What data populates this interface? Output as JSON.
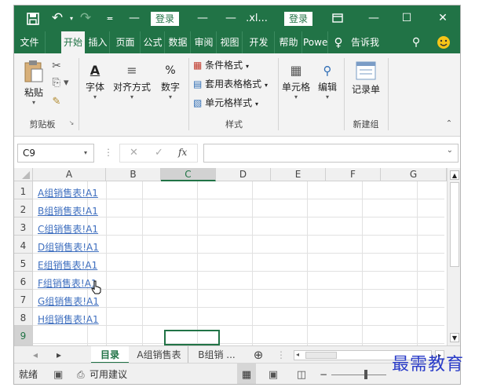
{
  "titlebar": {
    "save_icon": "save-icon",
    "undo_icon": "undo-icon",
    "redo_icon": "redo-icon",
    "customize_icon": "customize-qat-icon",
    "login_label": "登录",
    "filename": ".xl...",
    "login_label2": "登录",
    "ribbon_display_icon": "ribbon-display-icon",
    "minimize": "—",
    "maximize": "☐",
    "close": "✕"
  },
  "menu": {
    "items": [
      "文件",
      "开始",
      "插入",
      "页面",
      "公式",
      "数据",
      "审阅",
      "视图",
      "开发",
      "帮助",
      "Powe",
      "告诉我"
    ],
    "tell_icon": "lightbulb-icon",
    "share_icon": "share-icon",
    "smile_icon": "smiley-icon"
  },
  "ribbon": {
    "paste": "粘贴",
    "clipboard_group": "剪贴板",
    "font": "字体",
    "align": "对齐方式",
    "number": "数字",
    "cond_format": "条件格式",
    "table_format": "套用表格格式",
    "cell_style": "单元格样式",
    "styles_group": "样式",
    "cells": "单元格",
    "edit": "编辑",
    "record": "记录单",
    "new_group": "新建组",
    "percent_icon": "%",
    "font_icon": "A"
  },
  "formula_bar": {
    "cell_ref": "C9",
    "fx": "fx",
    "formula": ""
  },
  "columns": [
    "A",
    "B",
    "C",
    "D",
    "E",
    "F",
    "G"
  ],
  "rows": [
    "1",
    "2",
    "3",
    "4",
    "5",
    "6",
    "7",
    "8",
    "9"
  ],
  "cells": [
    "A组销售表!A1",
    "B组销售表!A1",
    "C组销售表!A1",
    "D组销售表!A1",
    "E组销售表!A1",
    "F组销售表!A1",
    "G组销售表!A1",
    "H组销售表!A1"
  ],
  "sheet_tabs": {
    "prev": "◂",
    "next": "▸",
    "tabs": [
      "目录",
      "A组销售表",
      "B组销 ..."
    ],
    "add": "⊕"
  },
  "status": {
    "ready": "就绪",
    "accessibility": "可用建议",
    "zoom_minus": "−",
    "zoom_plus": "+"
  },
  "watermark": "最需教育",
  "colors": {
    "accent": "#217346",
    "link": "#3f6fbf"
  }
}
